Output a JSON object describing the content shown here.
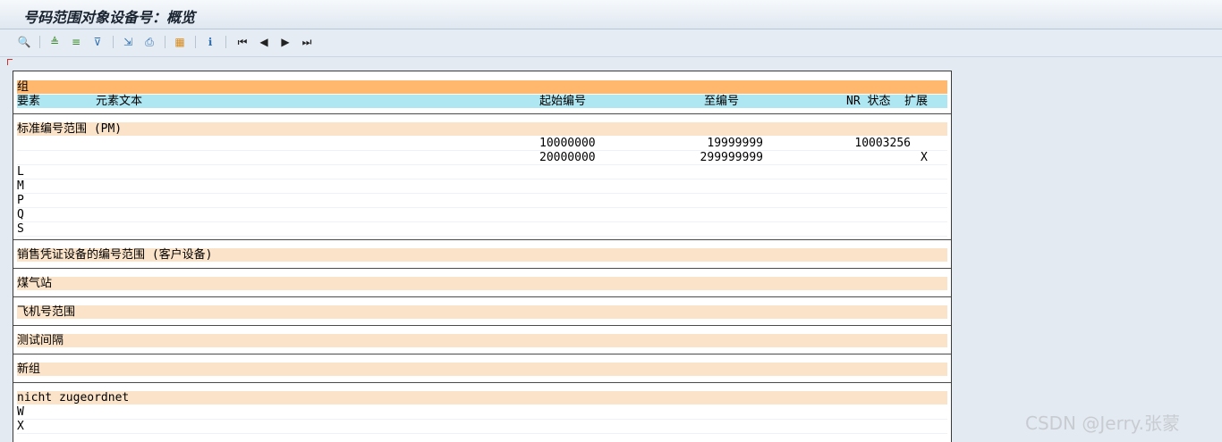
{
  "window": {
    "title": "号码范围对象设备号：概览"
  },
  "toolbar": {
    "buttons": [
      {
        "name": "display-icon",
        "glyph": "🔍",
        "color": "#3a7a2a"
      },
      {
        "name": "sort-asc-icon",
        "glyph": "≜",
        "color": "#3a8a2a"
      },
      {
        "name": "sort-desc-icon",
        "glyph": "≡",
        "color": "#3a8a2a"
      },
      {
        "name": "filter-icon",
        "glyph": "⊽",
        "color": "#2f6fb0"
      },
      {
        "name": "export-icon",
        "glyph": "⇲",
        "color": "#2f6fb0"
      },
      {
        "name": "print-icon",
        "glyph": "⎙",
        "color": "#2f6fb0"
      },
      {
        "name": "layout-grid-icon",
        "glyph": "▦",
        "color": "#d88a1a"
      },
      {
        "name": "info-icon",
        "glyph": "ℹ",
        "color": "#2f6fb0"
      },
      {
        "name": "first-page-icon",
        "glyph": "⏮",
        "color": "#222"
      },
      {
        "name": "prev-page-icon",
        "glyph": "◀",
        "color": "#222"
      },
      {
        "name": "next-page-icon",
        "glyph": "▶",
        "color": "#222"
      },
      {
        "name": "last-page-icon",
        "glyph": "⏭",
        "color": "#222"
      }
    ]
  },
  "list": {
    "group_header": "组",
    "columns": {
      "element": "要素",
      "element_text": "元素文本",
      "from_number": "起始编号",
      "to_number": "至编号",
      "nr_status": "NR 状态",
      "external": "扩展"
    },
    "groups": [
      {
        "name": "标准编号范围 (PM)",
        "rows": [
          {
            "element": "",
            "from": "10000000",
            "to": "19999999",
            "nr": "10003256",
            "ext": ""
          },
          {
            "element": "",
            "from": "20000000",
            "to": "299999999",
            "nr": "",
            "ext": "X"
          },
          {
            "element": "L",
            "from": "",
            "to": "",
            "nr": "",
            "ext": ""
          },
          {
            "element": "M",
            "from": "",
            "to": "",
            "nr": "",
            "ext": ""
          },
          {
            "element": "P",
            "from": "",
            "to": "",
            "nr": "",
            "ext": ""
          },
          {
            "element": "Q",
            "from": "",
            "to": "",
            "nr": "",
            "ext": ""
          },
          {
            "element": "S",
            "from": "",
            "to": "",
            "nr": "",
            "ext": ""
          }
        ]
      },
      {
        "name": "销售凭证设备的编号范围 (客户设备)",
        "rows": []
      },
      {
        "name": "煤气站",
        "rows": []
      },
      {
        "name": "飞机号范围",
        "rows": []
      },
      {
        "name": "测试间隔",
        "rows": []
      },
      {
        "name": "新组",
        "rows": []
      },
      {
        "name": "nicht zugeordnet",
        "rows": [
          {
            "element": "W",
            "from": "",
            "to": "",
            "nr": "",
            "ext": ""
          },
          {
            "element": "X",
            "from": "",
            "to": "",
            "nr": "",
            "ext": ""
          }
        ]
      }
    ]
  },
  "watermark": "CSDN @Jerry.张蒙"
}
